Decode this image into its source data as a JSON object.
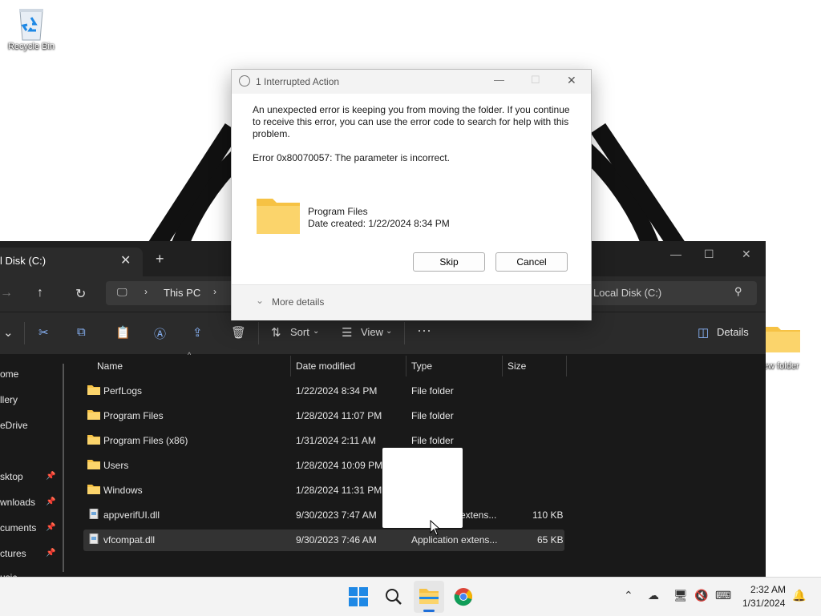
{
  "desktop": {
    "icons": [
      {
        "label": "Recycle Bin"
      },
      {
        "label": "ew folder"
      }
    ]
  },
  "explorer": {
    "tab": {
      "title": "l Disk (C:)"
    },
    "breadcrumb": {
      "root": "This PC"
    },
    "search": {
      "placeholder": "Local Disk (C:)"
    },
    "toolbar": {
      "sort_label": "Sort",
      "view_label": "View",
      "details_label": "Details"
    },
    "nav_items": [
      {
        "label": "ome",
        "pinned": false
      },
      {
        "label": "llery",
        "pinned": false
      },
      {
        "label": "eDrive",
        "pinned": false
      },
      {
        "label": "sktop",
        "pinned": true
      },
      {
        "label": "wnloads",
        "pinned": true
      },
      {
        "label": "cuments",
        "pinned": true
      },
      {
        "label": "ctures",
        "pinned": true
      },
      {
        "label": "usic",
        "pinned": true
      }
    ],
    "columns": {
      "name": "Name",
      "date": "Date modified",
      "type": "Type",
      "size": "Size"
    },
    "rows": [
      {
        "name": "PerfLogs",
        "date": "1/22/2024 8:34 PM",
        "type": "File folder",
        "size": "",
        "icon": "folder-icon"
      },
      {
        "name": "Program Files",
        "date": "1/28/2024 11:07 PM",
        "type": "File folder",
        "size": "",
        "icon": "folder-icon"
      },
      {
        "name": "Program Files (x86)",
        "date": "1/31/2024 2:11 AM",
        "type": "File folder",
        "size": "",
        "icon": "folder-icon"
      },
      {
        "name": "Users",
        "date": "1/28/2024 10:09 PM",
        "type": "",
        "size": "",
        "icon": "folder-icon"
      },
      {
        "name": "Windows",
        "date": "1/28/2024 11:31 PM",
        "type": "",
        "size": "",
        "icon": "folder-icon"
      },
      {
        "name": "appverifUI.dll",
        "date": "9/30/2023 7:47 AM",
        "type": "extens...",
        "size": "110 KB",
        "icon": "dll-file-icon"
      },
      {
        "name": "vfcompat.dll",
        "date": "9/30/2023 7:46 AM",
        "type": "Application extens...",
        "size": "65 KB",
        "icon": "dll-file-icon"
      }
    ]
  },
  "dialog": {
    "title": "1 Interrupted Action",
    "message": "An unexpected error is keeping you from moving the folder. If you continue to receive this error, you can use the error code to search for help with this problem.",
    "error": "Error 0x80070057: The parameter is incorrect.",
    "item_name": "Program Files",
    "item_date": "Date created: 1/22/2024 8:34 PM",
    "skip_label": "Skip",
    "cancel_label": "Cancel",
    "more_details_label": "More details"
  },
  "taskbar": {
    "time": "2:32 AM",
    "date": "1/31/2024"
  }
}
